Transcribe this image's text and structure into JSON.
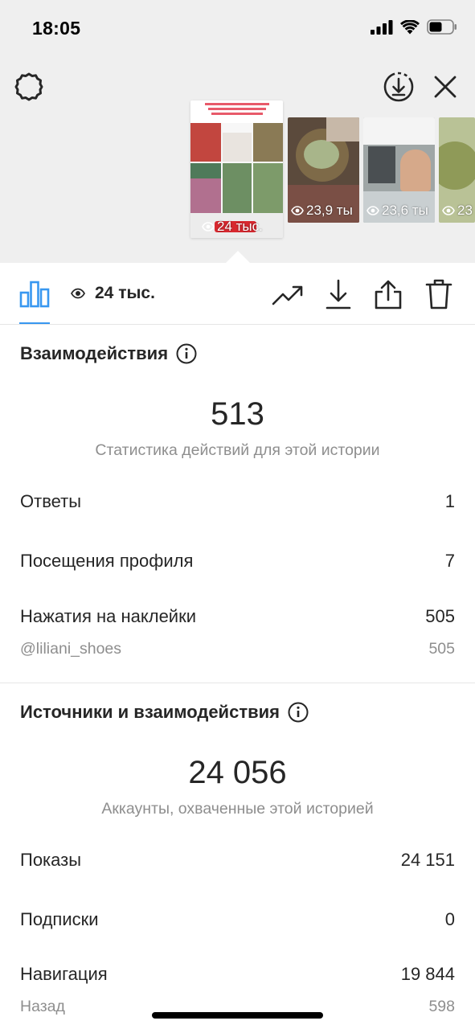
{
  "status_bar": {
    "time": "18:05"
  },
  "header": {
    "settings_icon": "gear-icon",
    "download_icon": "download-circle-icon",
    "close_icon": "close-icon"
  },
  "stories": [
    {
      "views": "24 тыс.",
      "selected": true
    },
    {
      "views": "23,9 ты"
    },
    {
      "views": "23,6 ты"
    },
    {
      "views": "23"
    }
  ],
  "toolbar": {
    "views": "24 тыс.",
    "icons": [
      "bar-chart-icon",
      "eye-icon",
      "trending-icon",
      "download-icon",
      "share-icon",
      "trash-icon"
    ]
  },
  "interactions": {
    "title": "Взаимодействия",
    "total": "513",
    "caption": "Статистика действий для этой истории",
    "rows": [
      {
        "label": "Ответы",
        "value": "1"
      },
      {
        "label": "Посещения профиля",
        "value": "7"
      },
      {
        "label": "Нажатия на наклейки",
        "value": "505"
      }
    ],
    "sub_row": {
      "label": "@liliani_shoes",
      "value": "505"
    }
  },
  "discovery": {
    "title": "Источники и взаимодействия",
    "total": "24 056",
    "caption": "Аккаунты, охваченные этой историей",
    "rows": [
      {
        "label": "Показы",
        "value": "24 151"
      },
      {
        "label": "Подписки",
        "value": "0"
      },
      {
        "label": "Навигация",
        "value": "19 844"
      }
    ],
    "sub_row": {
      "label": "Назад",
      "value": "598"
    }
  },
  "colors": {
    "accent": "#3897f0",
    "text_primary": "#262626",
    "text_secondary": "#8e8e8e",
    "top_background": "#efefef"
  }
}
